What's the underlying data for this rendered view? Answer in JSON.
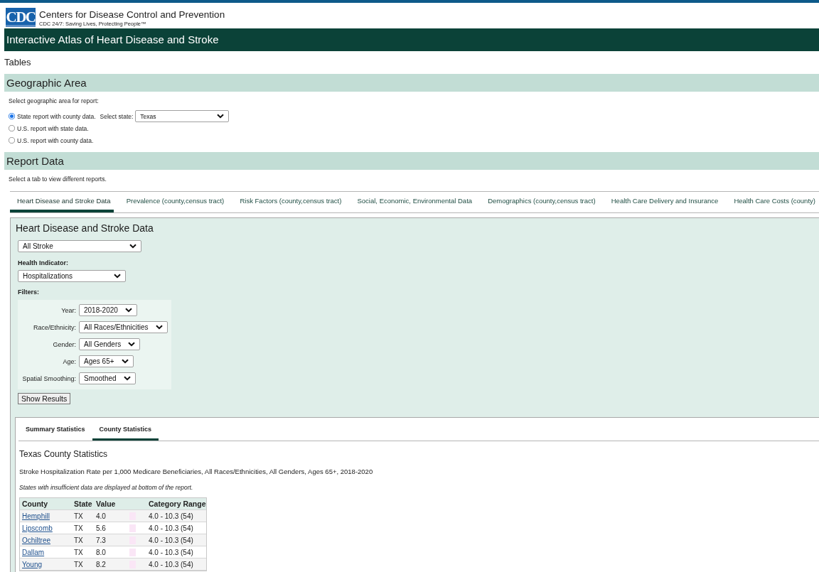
{
  "header": {
    "logo_text": "CDC",
    "org_name": "Centers for Disease Control and Prevention",
    "tagline": "CDC 24/7: Saving Lives, Protecting People™",
    "title": "Interactive Atlas of Heart Disease and Stroke"
  },
  "page_heading": "Tables",
  "geographic_area": {
    "heading": "Geographic Area",
    "prompt": "Select geographic area for report:",
    "options": [
      {
        "label": "State report with county data.",
        "selected": true,
        "state_label": "Select state:",
        "state_value": "Texas"
      },
      {
        "label": "U.S. report with state data.",
        "selected": false
      },
      {
        "label": "U.S. report with county data.",
        "selected": false
      }
    ]
  },
  "report_data": {
    "heading": "Report Data",
    "prompt": "Select a tab to view different reports.",
    "tabs": [
      {
        "label": "Heart Disease and Stroke Data",
        "selected": true
      },
      {
        "label": "Prevalence (county,census tract)",
        "selected": false
      },
      {
        "label": "Risk Factors (county,census tract)",
        "selected": false
      },
      {
        "label": "Social, Economic, Environmental Data",
        "selected": false
      },
      {
        "label": "Demographics (county,census tract)",
        "selected": false
      },
      {
        "label": "Health Care Delivery and Insurance",
        "selected": false
      },
      {
        "label": "Health Care Costs (county)",
        "selected": false
      }
    ],
    "panel": {
      "title": "Heart Disease and Stroke Data",
      "topic": "All Stroke",
      "indicator_label": "Health Indicator:",
      "indicator": "Hospitalizations",
      "filters_label": "Filters:",
      "filters": [
        {
          "label": "Year:",
          "value": "2018-2020"
        },
        {
          "label": "Race/Ethnicity:",
          "value": "All Races/Ethnicities"
        },
        {
          "label": "Gender:",
          "value": "All Genders"
        },
        {
          "label": "Age:",
          "value": "Ages 65+"
        },
        {
          "label": "Spatial Smoothing:",
          "value": "Smoothed"
        }
      ],
      "submit_button": "Show Results",
      "result_tabs": [
        {
          "label": "Summary Statistics",
          "selected": false
        },
        {
          "label": "County Statistics",
          "selected": true
        }
      ],
      "results": {
        "title": "Texas County Statistics",
        "description": "Stroke Hospitalization Rate per 1,000 Medicare Beneficiaries, All Races/Ethnicities, All Genders, Ages 65+, 2018-2020",
        "note": "States with insufficient data are displayed at bottom of the report.",
        "table": {
          "columns": [
            {
              "kind": "text",
              "label": "County"
            },
            {
              "kind": "text",
              "label": "State"
            },
            {
              "kind": "text",
              "label": "Value"
            },
            {
              "kind": "swatch"
            },
            {
              "kind": "text",
              "label": "Category Range"
            }
          ],
          "rows": [
            {
              "county": "Hemphill",
              "state": "TX",
              "value": "4.0",
              "color": "#fae6f6",
              "category_range": "4.0 - 10.3 (54)"
            },
            {
              "county": "Lipscomb",
              "state": "TX",
              "value": "5.6",
              "color": "#fae6f6",
              "category_range": "4.0 - 10.3 (54)"
            },
            {
              "county": "Ochiltree",
              "state": "TX",
              "value": "7.3",
              "color": "#fae6f6",
              "category_range": "4.0 - 10.3 (54)"
            },
            {
              "county": "Dallam",
              "state": "TX",
              "value": "8.0",
              "color": "#fae6f6",
              "category_range": "4.0 - 10.3 (54)"
            },
            {
              "county": "Young",
              "state": "TX",
              "value": "8.2",
              "color": "#fae6f6",
              "category_range": "4.0 - 10.3 (54)"
            }
          ]
        }
      }
    }
  }
}
